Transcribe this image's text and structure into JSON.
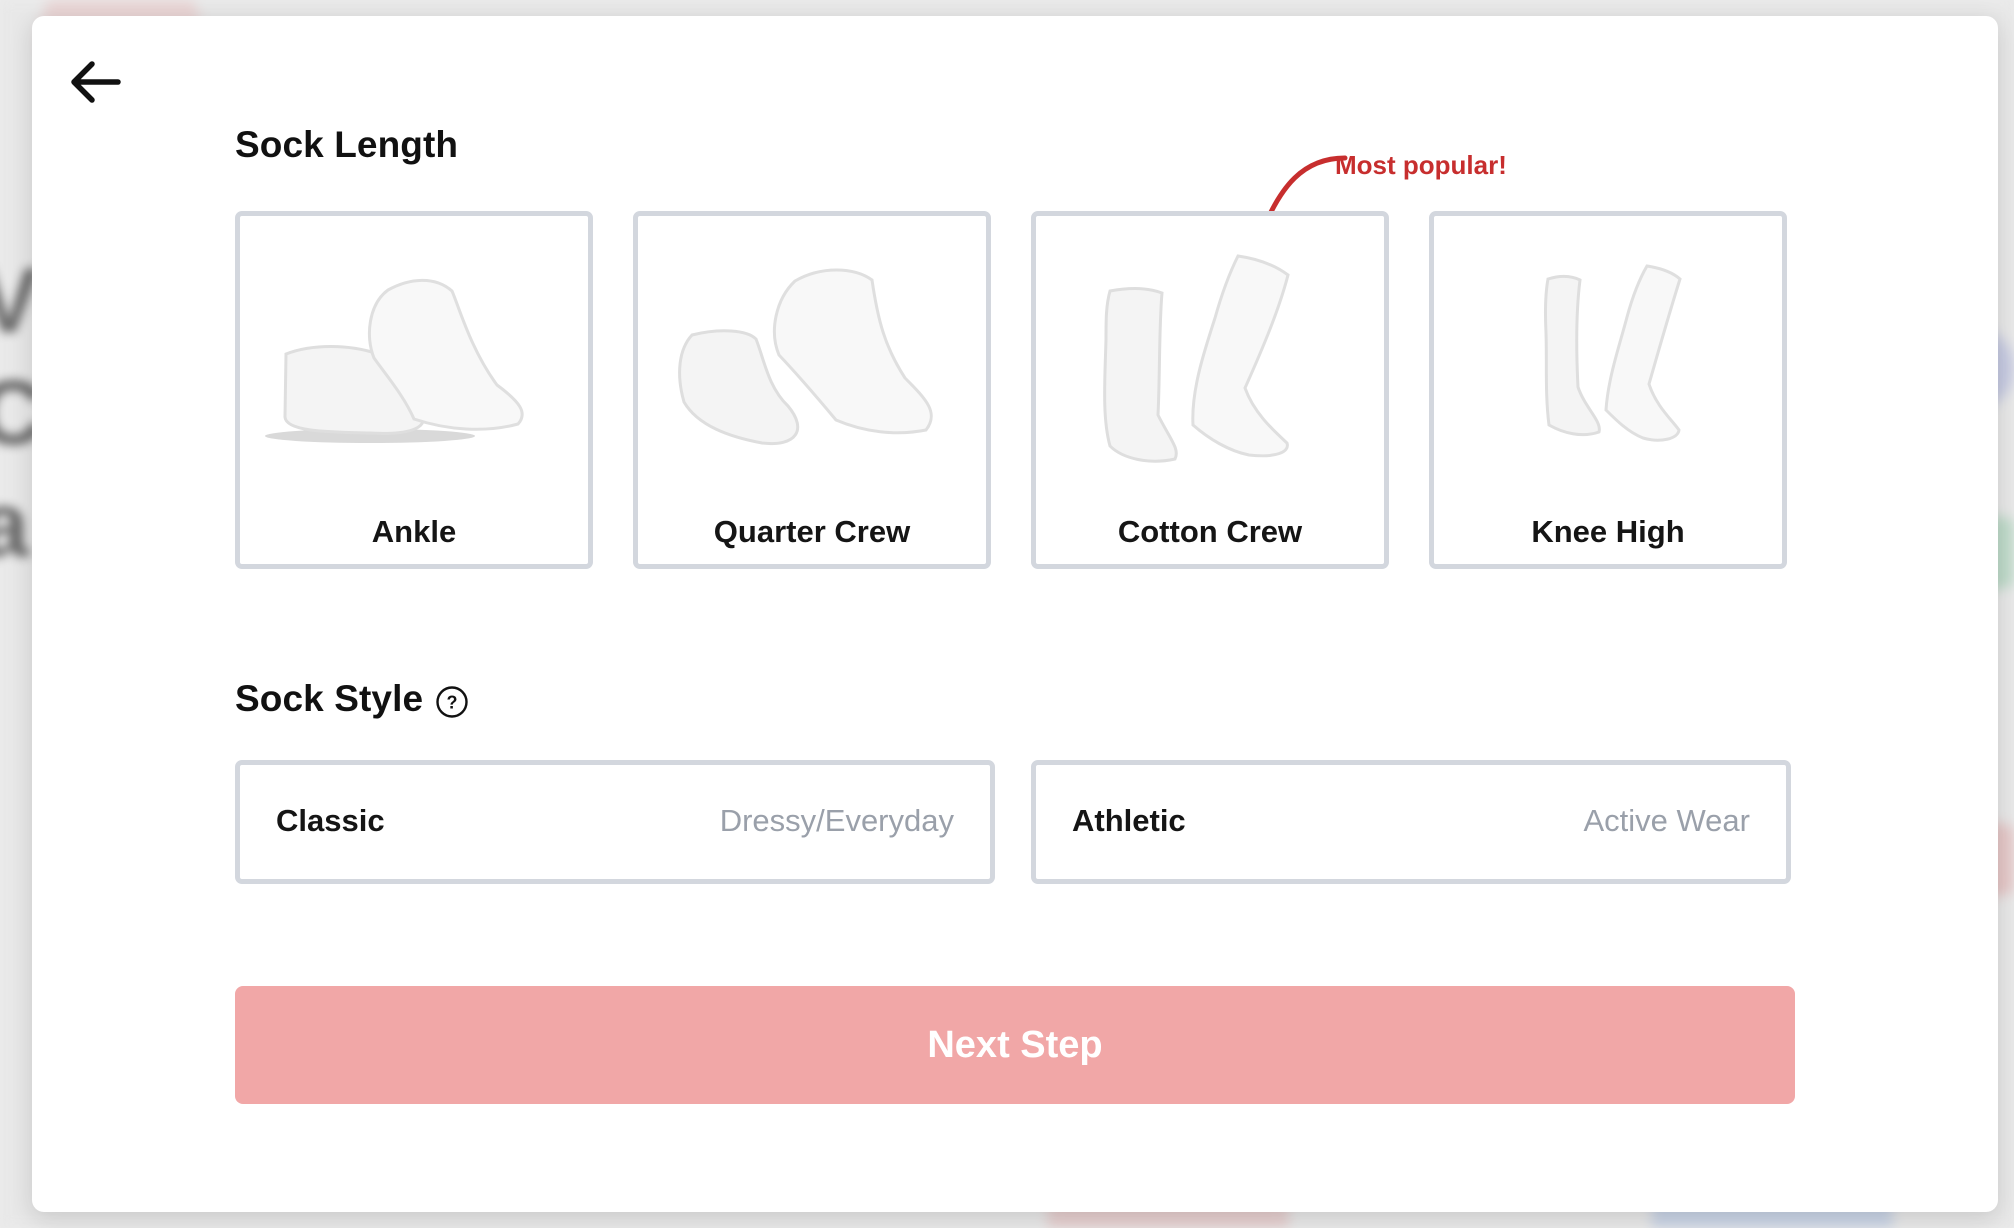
{
  "modal": {
    "back_icon": "back-arrow-icon",
    "sock_length_title": "Sock Length",
    "sock_style_title": "Sock Style",
    "help_icon": "question-circle-icon",
    "popular_note": "Most popular!",
    "next_step_label": "Next Step",
    "next_step_color": "#f1a7a7"
  },
  "sock_lengths": [
    {
      "label": "Ankle",
      "icon": "ankle-socks-icon"
    },
    {
      "label": "Quarter Crew",
      "icon": "quarter-crew-socks-icon"
    },
    {
      "label": "Cotton Crew",
      "icon": "cotton-crew-socks-icon"
    },
    {
      "label": "Knee High",
      "icon": "knee-high-socks-icon"
    }
  ],
  "sock_styles": [
    {
      "label": "Classic",
      "description": "Dressy/Everyday"
    },
    {
      "label": "Athletic",
      "description": "Active Wear"
    }
  ]
}
